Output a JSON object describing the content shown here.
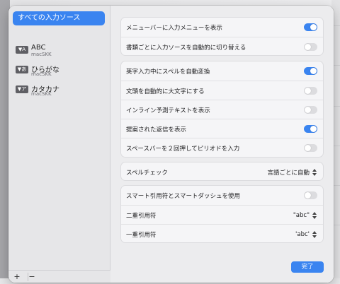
{
  "sidebar": {
    "selected_label": "すべての入力ソース",
    "sources": [
      {
        "name": "ABC",
        "sub": "macSKK",
        "badge": "A"
      },
      {
        "name": "ひらがな",
        "sub": "macSKK",
        "badge": "あ"
      },
      {
        "name": "カタカナ",
        "sub": "macSKK",
        "badge": "ア"
      }
    ],
    "add_label": "+",
    "remove_label": "−"
  },
  "settings": {
    "group1": [
      {
        "label": "メニューバーに入力メニューを表示",
        "on": true
      },
      {
        "label": "書類ごとに入力ソースを自動的に切り替える",
        "on": false
      }
    ],
    "group2": [
      {
        "label": "英字入力中にスペルを自動変換",
        "on": true
      },
      {
        "label": "文頭を自動的に大文字にする",
        "on": false
      },
      {
        "label": "インライン予測テキストを表示",
        "on": false
      },
      {
        "label": "提案された返信を表示",
        "on": true
      },
      {
        "label": "スペースバーを２回押してピリオドを入力",
        "on": false
      }
    ],
    "spellcheck": {
      "label": "スペルチェック",
      "value": "言語ごとに自動"
    },
    "quotes": {
      "smart_label": "スマート引用符とスマートダッシュを使用",
      "smart_on": false,
      "double_label": "二重引用符",
      "double_value": "\"abc\"",
      "single_label": "一重引用符",
      "single_value": "'abc'"
    }
  },
  "done_label": "完了",
  "colors": {
    "accent": "#3a84f0"
  }
}
